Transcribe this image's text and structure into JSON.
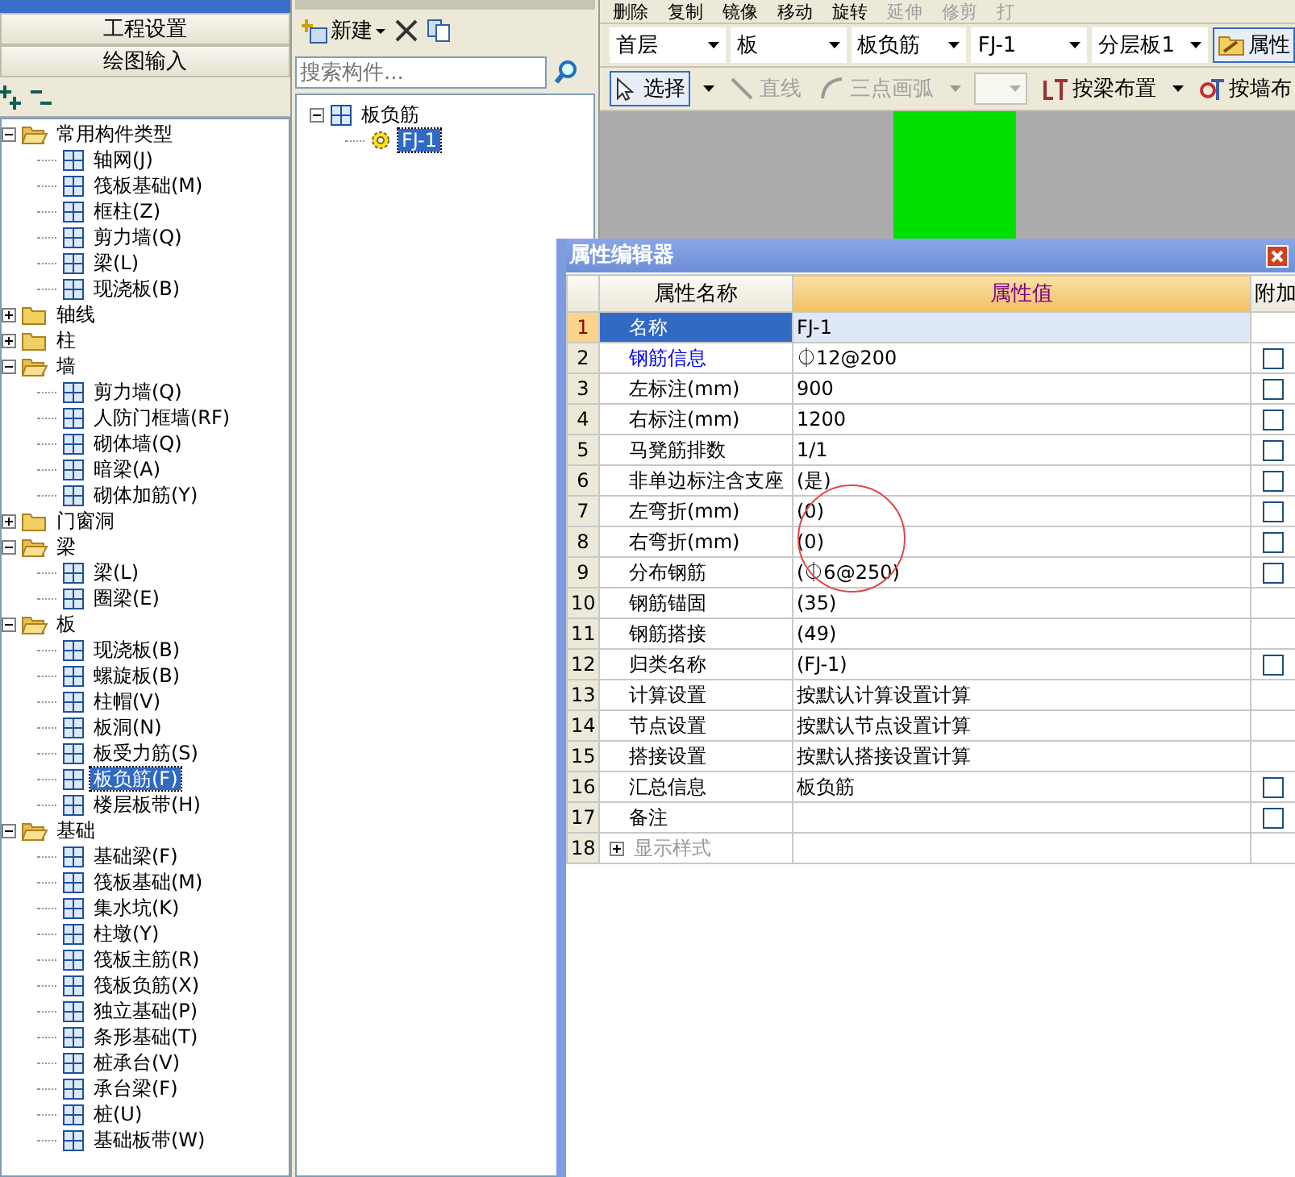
{
  "left_panel": {
    "buttons": [
      "工程设置",
      "绘图输入"
    ],
    "tree": [
      {
        "label": "常用构件类型",
        "expanded": true,
        "children": [
          {
            "label": "轴网(J)",
            "selected": false
          },
          {
            "label": "筏板基础(M)",
            "selected": false
          },
          {
            "label": "框柱(Z)",
            "selected": false
          },
          {
            "label": "剪力墙(Q)",
            "selected": false
          },
          {
            "label": "梁(L)",
            "selected": false
          },
          {
            "label": "现浇板(B)",
            "selected": false
          }
        ]
      },
      {
        "label": "轴线",
        "expanded": false
      },
      {
        "label": "柱",
        "expanded": false
      },
      {
        "label": "墙",
        "expanded": true,
        "children": [
          {
            "label": "剪力墙(Q)",
            "selected": false
          },
          {
            "label": "人防门框墙(RF)",
            "selected": false
          },
          {
            "label": "砌体墙(Q)",
            "selected": false
          },
          {
            "label": "暗梁(A)",
            "selected": false
          },
          {
            "label": "砌体加筋(Y)",
            "selected": false
          }
        ]
      },
      {
        "label": "门窗洞",
        "expanded": false
      },
      {
        "label": "梁",
        "expanded": true,
        "children": [
          {
            "label": "梁(L)",
            "selected": false
          },
          {
            "label": "圈梁(E)",
            "selected": false
          }
        ]
      },
      {
        "label": "板",
        "expanded": true,
        "children": [
          {
            "label": "现浇板(B)",
            "selected": false
          },
          {
            "label": "螺旋板(B)",
            "selected": false
          },
          {
            "label": "柱帽(V)",
            "selected": false
          },
          {
            "label": "板洞(N)",
            "selected": false
          },
          {
            "label": "板受力筋(S)",
            "selected": false
          },
          {
            "label": "板负筋(F)",
            "selected": true
          },
          {
            "label": "楼层板带(H)",
            "selected": false
          }
        ]
      },
      {
        "label": "基础",
        "expanded": true,
        "children": [
          {
            "label": "基础梁(F)",
            "selected": false
          },
          {
            "label": "筏板基础(M)",
            "selected": false
          },
          {
            "label": "集水坑(K)",
            "selected": false
          },
          {
            "label": "柱墩(Y)",
            "selected": false
          },
          {
            "label": "筏板主筋(R)",
            "selected": false
          },
          {
            "label": "筏板负筋(X)",
            "selected": false
          },
          {
            "label": "独立基础(P)",
            "selected": false
          },
          {
            "label": "条形基础(T)",
            "selected": false
          },
          {
            "label": "桩承台(V)",
            "selected": false
          },
          {
            "label": "承台梁(F)",
            "selected": false
          },
          {
            "label": "桩(U)",
            "selected": false
          },
          {
            "label": "基础板带(W)",
            "selected": false
          }
        ]
      }
    ]
  },
  "component_list": {
    "new_button": "新建",
    "search": {
      "placeholder": "搜索构件..."
    },
    "tree": [
      {
        "label": "板负筋",
        "expanded": true,
        "children": [
          {
            "label": "FJ-1",
            "selected": true
          }
        ]
      }
    ]
  },
  "edit_toolbar": [
    {
      "label": "删除",
      "disabled": false
    },
    {
      "label": "复制",
      "disabled": false
    },
    {
      "label": "镜像",
      "disabled": false
    },
    {
      "label": "移动",
      "disabled": false
    },
    {
      "label": "旋转",
      "disabled": false
    },
    {
      "label": "延伸",
      "disabled": true
    },
    {
      "label": "修剪",
      "disabled": true
    },
    {
      "label": "打",
      "disabled": true
    }
  ],
  "selectors": [
    {
      "value": "首层"
    },
    {
      "value": "板"
    },
    {
      "value": "板负筋"
    },
    {
      "value": "FJ-1"
    },
    {
      "value": "分层板1"
    }
  ],
  "property_button": {
    "label": "属性",
    "pressed": true
  },
  "draw_toolbar": [
    {
      "kind": "button",
      "label": "选择",
      "pressed": true,
      "disabled": false,
      "dropdown": true
    },
    {
      "kind": "button",
      "label": "直线",
      "pressed": false,
      "disabled": true,
      "dropdown": false
    },
    {
      "kind": "button",
      "label": "三点画弧",
      "pressed": false,
      "disabled": true,
      "dropdown": true
    },
    {
      "kind": "combo",
      "disabled": true
    },
    {
      "kind": "button",
      "label": "按梁布置",
      "pressed": false,
      "disabled": false,
      "dropdown": true
    },
    {
      "kind": "button",
      "label": "按墙布",
      "pressed": false,
      "disabled": false,
      "dropdown": false
    }
  ],
  "property_editor": {
    "title": "属性编辑器",
    "columns": [
      "属性名称",
      "属性值",
      "附加"
    ],
    "rows": [
      {
        "number": "1",
        "name": "名称",
        "value": "FJ-1",
        "kind": "normal",
        "selected": true
      },
      {
        "number": "2",
        "name": "钢筋信息",
        "value": "⏀12@200",
        "kind": "link",
        "selected": false,
        "attach_checked": false
      },
      {
        "number": "3",
        "name": "左标注(mm)",
        "value": "900",
        "kind": "normal",
        "selected": false,
        "attach_checked": false
      },
      {
        "number": "4",
        "name": "右标注(mm)",
        "value": "1200",
        "kind": "normal",
        "selected": false,
        "attach_checked": false
      },
      {
        "number": "5",
        "name": "马凳筋排数",
        "value": "1/1",
        "kind": "normal",
        "selected": false,
        "attach_checked": false
      },
      {
        "number": "6",
        "name": "非单边标注含支座",
        "value": "(是)",
        "kind": "normal",
        "selected": false,
        "attach_checked": false
      },
      {
        "number": "7",
        "name": "左弯折(mm)",
        "value": "(0)",
        "kind": "normal",
        "selected": false,
        "attach_checked": false
      },
      {
        "number": "8",
        "name": "右弯折(mm)",
        "value": "(0)",
        "kind": "normal",
        "selected": false,
        "attach_checked": false
      },
      {
        "number": "9",
        "name": "分布钢筋",
        "value": "(⏀6@250)",
        "kind": "normal",
        "selected": false,
        "attach_checked": false
      },
      {
        "number": "10",
        "name": "钢筋锚固",
        "value": "(35)",
        "kind": "normal",
        "selected": false
      },
      {
        "number": "11",
        "name": "钢筋搭接",
        "value": "(49)",
        "kind": "normal",
        "selected": false
      },
      {
        "number": "12",
        "name": "归类名称",
        "value": "(FJ-1)",
        "kind": "normal",
        "selected": false,
        "attach_checked": false
      },
      {
        "number": "13",
        "name": "计算设置",
        "value": "按默认计算设置计算",
        "kind": "normal",
        "selected": false
      },
      {
        "number": "14",
        "name": "节点设置",
        "value": "按默认节点设置计算",
        "kind": "normal",
        "selected": false
      },
      {
        "number": "15",
        "name": "搭接设置",
        "value": "按默认搭接设置计算",
        "kind": "normal",
        "selected": false
      },
      {
        "number": "16",
        "name": "汇总信息",
        "value": "板负筋",
        "kind": "normal",
        "selected": false,
        "attach_checked": false
      },
      {
        "number": "17",
        "name": "备注",
        "kind": "normal",
        "selected": false,
        "attach_checked": false
      },
      {
        "number": "18",
        "name": "显示样式",
        "kind": "group",
        "expanded": false,
        "selected": false
      }
    ]
  }
}
